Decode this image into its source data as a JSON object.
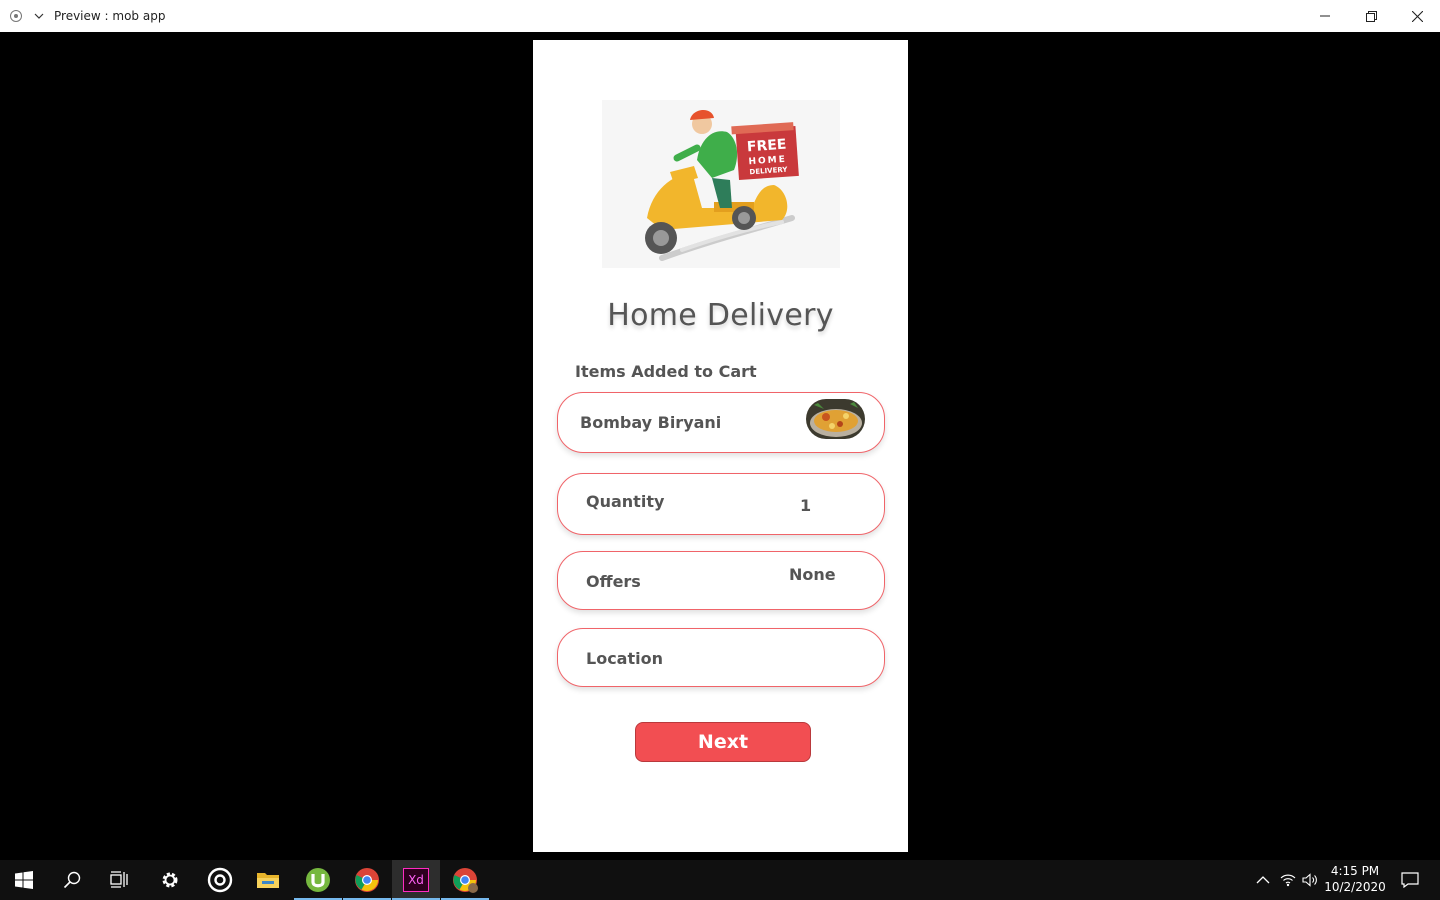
{
  "window": {
    "title": "Preview : mob app"
  },
  "app": {
    "hero_image": "free-home-delivery-scooter-illustration",
    "hero_text": "FREE HOME DELIVERY",
    "page_title": "Home Delivery",
    "section_label": "Items Added to Cart",
    "cart_item": {
      "name": "Bombay Biryani",
      "thumb": "biryani-food-photo"
    },
    "quantity": {
      "label": "Quantity",
      "value": "1"
    },
    "offers": {
      "label": "Offers",
      "value": "None"
    },
    "location": {
      "label": "Location"
    },
    "next_label": "Next",
    "colors": {
      "accent": "#f24e52",
      "pill_border": "#f06469",
      "text": "#555555"
    }
  },
  "taskbar": {
    "icons": [
      "windows-start-icon",
      "search-icon",
      "task-view-icon",
      "settings-icon",
      "groove-icon",
      "file-explorer-icon",
      "utorrent-icon",
      "chrome-icon",
      "adobe-xd-icon",
      "chrome-profile-icon"
    ],
    "xd_label": "Xd",
    "time": "4:15 PM",
    "date": "10/2/2020"
  }
}
